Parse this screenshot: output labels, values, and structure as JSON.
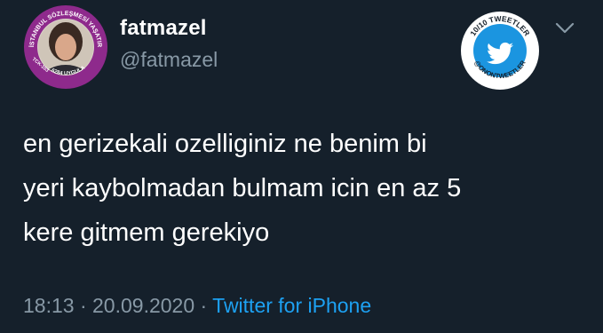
{
  "user": {
    "display_name": "fatmazel",
    "handle": "@fatmazel",
    "avatar_ring_text": "İSTANBUL SÖZLEŞMESİ YAŞATIR",
    "avatar_bottom_text": "6284 UYGULA",
    "avatar_left_text": "TCK-103"
  },
  "badge": {
    "top_text": "10/10 TWEETLER",
    "bottom_text": "@ONONTWEETLER"
  },
  "tweet": {
    "lines": [
      "en gerizekali ozelliginiz ne benim bi",
      "yeri kaybolmadan bulmam icin en az 5",
      "kere gitmem gerekiyo"
    ]
  },
  "meta": {
    "time": "18:13",
    "separator": " · ",
    "date": "20.09.2020",
    "source": "Twitter for iPhone"
  },
  "icons": {
    "chevron": "chevron-down-icon",
    "bird": "twitter-bird-icon"
  },
  "colors": {
    "background": "#15202b",
    "text_primary": "#ffffff",
    "text_secondary": "#8899a6",
    "accent": "#1da1f2",
    "avatar_ring": "#8e2a8c"
  }
}
